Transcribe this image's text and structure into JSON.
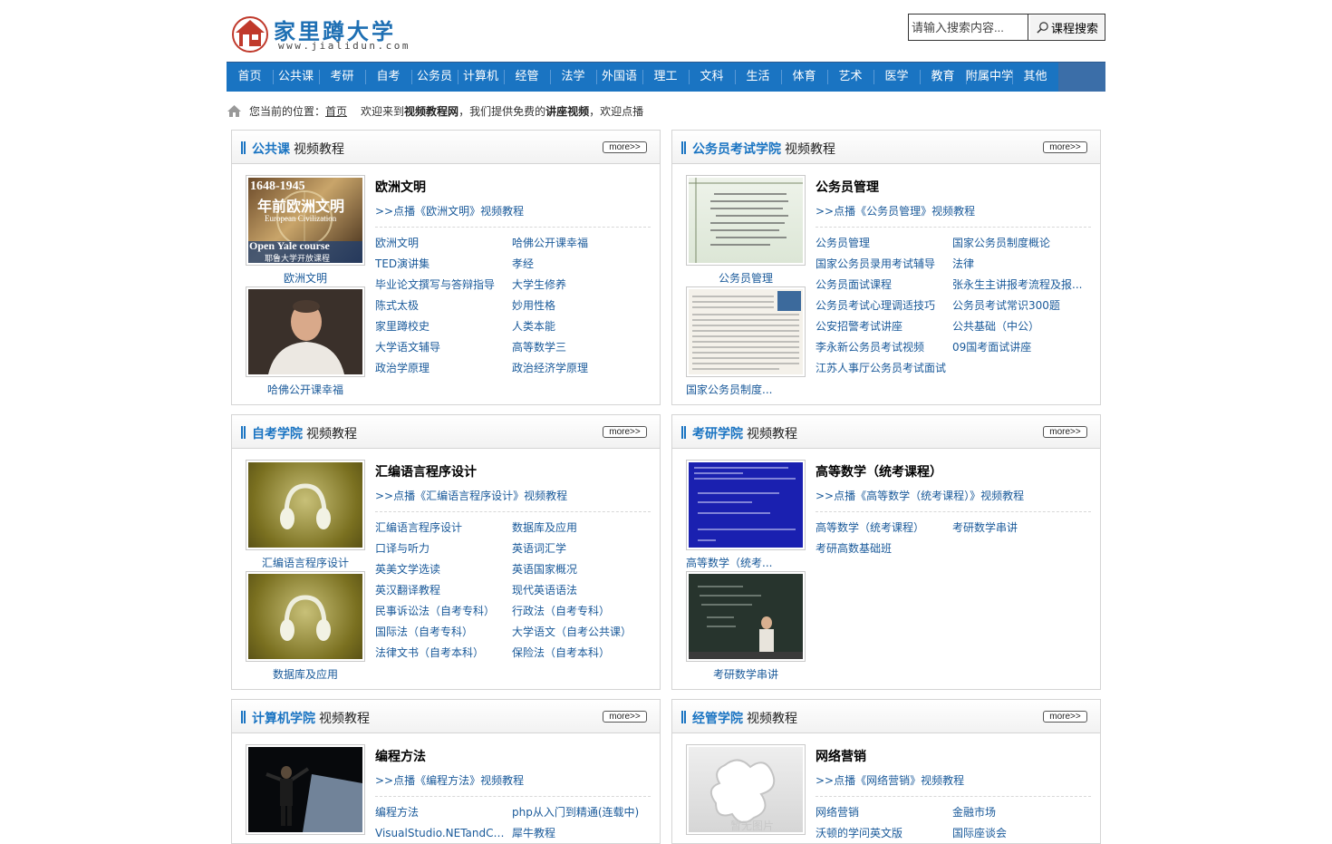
{
  "header": {
    "logo_text": "家里蹲大学",
    "logo_url": "www.jialidun.com",
    "search_placeholder": "请输入搜索内容...",
    "search_button": "课程搜索"
  },
  "nav": [
    "首页",
    "公共课",
    "考研",
    "自考",
    "公务员",
    "计算机",
    "经管",
    "法学",
    "外国语",
    "理工",
    "文科",
    "生活",
    "体育",
    "艺术",
    "医学",
    "教育",
    "附属中学",
    "其他"
  ],
  "breadcrumb": {
    "prefix": "您当前的位置：",
    "home": "首页",
    "welcome_a": "欢迎来到",
    "welcome_b": "视频教程网",
    "welcome_c": "，我们提供免费的",
    "welcome_d": "讲座视频",
    "welcome_e": "，欢迎点播"
  },
  "panels": [
    {
      "category": "公共课",
      "subtitle": "视频教程",
      "more": "more>>",
      "feature_title": "欧洲文明",
      "feature_link": ">>点播《欧洲文明》视频教程",
      "thumbs": [
        {
          "caption": "欧洲文明",
          "overlay_1": "1648-1945",
          "overlay_2": "年前欧洲文明",
          "overlay_3": "European Civilization",
          "overlay_4": "Open Yale course",
          "overlay_5": "耶鲁大学开放课程"
        },
        {
          "caption": "哈佛公开课幸福"
        }
      ],
      "links": [
        "欧洲文明",
        "哈佛公开课幸福",
        "TED演讲集",
        "孝经",
        "毕业论文撰写与答辩指导",
        "大学生修养",
        "陈式太极",
        "妙用性格",
        "家里蹲校史",
        "人类本能",
        "大学语文辅导",
        "高等数学三",
        "政治学原理",
        "政治经济学原理"
      ]
    },
    {
      "category": "公务员考试学院",
      "subtitle": "视频教程",
      "more": "more>>",
      "feature_title": "公务员管理",
      "feature_link": ">>点播《公务员管理》视频教程",
      "thumbs": [
        {
          "caption": "公务员管理"
        },
        {
          "caption": "国家公务员制度..."
        }
      ],
      "links": [
        "公务员管理",
        "国家公务员制度概论",
        "国家公务员录用考试辅导",
        "法律",
        "公务员面试课程",
        "张永生主讲报考流程及报...",
        "公务员考试心理调适技巧",
        "公务员考试常识300题",
        "公安招警考试讲座",
        "公共基础（中公）",
        "李永新公务员考试视频",
        "09国考面试讲座",
        "江苏人事厅公务员考试面试"
      ]
    },
    {
      "category": "自考学院",
      "subtitle": "视频教程",
      "more": "more>>",
      "feature_title": "汇编语言程序设计",
      "feature_link": ">>点播《汇编语言程序设计》视频教程",
      "thumbs": [
        {
          "caption": "汇编语言程序设计"
        },
        {
          "caption": "数据库及应用"
        }
      ],
      "links": [
        "汇编语言程序设计",
        "数据库及应用",
        "口译与听力",
        "英语词汇学",
        "英美文学选读",
        "英语国家概况",
        "英汉翻译教程",
        "现代英语语法",
        "民事诉讼法（自考专科）",
        "行政法（自考专科）",
        "国际法（自考专科）",
        "大学语文（自考公共课）",
        "法律文书（自考本科）",
        "保险法（自考本科）"
      ]
    },
    {
      "category": "考研学院",
      "subtitle": "视频教程",
      "more": "more>>",
      "feature_title": "高等数学（统考课程）",
      "feature_link": ">>点播《高等数学（统考课程）》视频教程",
      "thumbs": [
        {
          "caption": "高等数学（统考..."
        },
        {
          "caption": "考研数学串讲"
        }
      ],
      "links": [
        "高等数学（统考课程）",
        "考研数学串讲",
        "考研高数基础班"
      ]
    },
    {
      "category": "计算机学院",
      "subtitle": "视频教程",
      "more": "more>>",
      "feature_title": "编程方法",
      "feature_link": ">>点播《编程方法》视频教程",
      "thumbs": [
        {
          "caption": "编程方法"
        }
      ],
      "links": [
        "编程方法",
        "php从入门到精通(连载中)",
        "VisualStudio.NETandC教程",
        "犀牛教程"
      ]
    },
    {
      "category": "经管学院",
      "subtitle": "视频教程",
      "more": "more>>",
      "feature_title": "网络营销",
      "feature_link": ">>点播《网络营销》视频教程",
      "thumbs": [
        {
          "caption": "网络营销",
          "overlay_1": "暂无图片"
        }
      ],
      "links": [
        "网络营销",
        "金融市场",
        "沃顿的学问英文版",
        "国际座谈会"
      ]
    }
  ]
}
